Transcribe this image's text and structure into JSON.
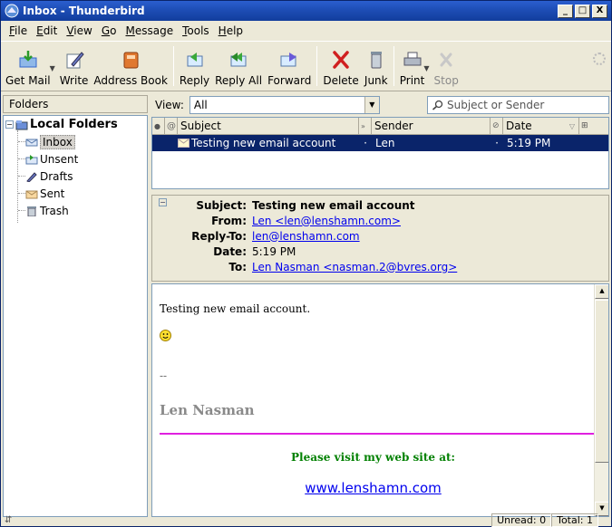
{
  "window": {
    "title": "Inbox - Thunderbird",
    "minimize": "_",
    "maximize": "□",
    "close": "X"
  },
  "menu": [
    {
      "key": "F",
      "rest": "ile"
    },
    {
      "key": "E",
      "rest": "dit"
    },
    {
      "key": "V",
      "rest": "iew"
    },
    {
      "key": "G",
      "rest": "o"
    },
    {
      "key": "M",
      "rest": "essage"
    },
    {
      "key": "T",
      "rest": "ools"
    },
    {
      "key": "H",
      "rest": "elp"
    }
  ],
  "toolbar": {
    "get_mail": "Get Mail",
    "write": "Write",
    "address_book": "Address Book",
    "reply": "Reply",
    "reply_all": "Reply All",
    "forward": "Forward",
    "delete": "Delete",
    "junk": "Junk",
    "print": "Print",
    "stop": "Stop"
  },
  "folders": {
    "header": "Folders",
    "root": "Local Folders",
    "items": [
      "Inbox",
      "Unsent",
      "Drafts",
      "Sent",
      "Trash"
    ],
    "selected": "Inbox"
  },
  "view": {
    "label": "View:",
    "selected": "All"
  },
  "search": {
    "placeholder": "Subject or Sender"
  },
  "thread": {
    "columns": {
      "subject": "Subject",
      "sender": "Sender",
      "date": "Date"
    },
    "rows": [
      {
        "subject": "Testing new email account",
        "sender": "Len",
        "date": "5:19 PM"
      }
    ]
  },
  "message_header": {
    "subject_label": "Subject:",
    "subject": "Testing new email account",
    "from_label": "From:",
    "from": "Len <len@lenshamn.com>",
    "reply_to_label": "Reply-To:",
    "reply_to": "len@lenshamn.com",
    "date_label": "Date:",
    "date": "5:19 PM",
    "to_label": "To:",
    "to": "Len Nasman <nasman.2@bvres.org>"
  },
  "message_body": {
    "text": "Testing new email account.",
    "sig_sep": "--",
    "sig_name": "Len Nasman",
    "visit": "Please visit my web site at:",
    "website": "www.lenshamn.com"
  },
  "status": {
    "unread": "Unread: 0",
    "total": "Total: 1"
  },
  "colors": {
    "title_bar": "#1f4fb8",
    "selection": "#0a246a",
    "signature_rule": "#e020e0",
    "visit_text": "#008000",
    "link": "#0000ee"
  }
}
